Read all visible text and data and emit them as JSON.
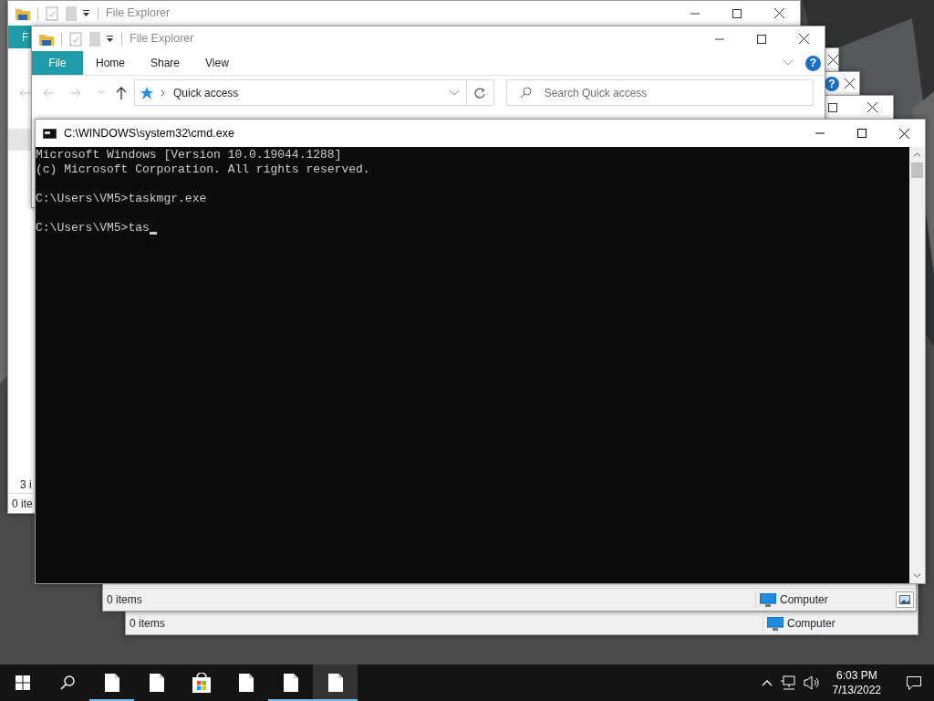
{
  "back_explorer": {
    "title": "File Explorer",
    "ribbon_tab": "F",
    "item_count": "3 i",
    "status": "0 ite"
  },
  "stacked_windows": [
    {
      "buttons": [
        {
          "kind": "close"
        }
      ]
    },
    {
      "buttons": [
        {
          "kind": "help",
          "label": "?"
        },
        {
          "kind": "close"
        }
      ]
    },
    {
      "buttons": [
        {
          "kind": "maximize"
        },
        {
          "kind": "close"
        }
      ]
    }
  ],
  "status_windows": [
    {
      "items": "0 items",
      "zone": "Computer",
      "view_button": true
    },
    {
      "items": "0 items",
      "zone": "Computer",
      "view_button": false
    }
  ],
  "front_explorer": {
    "title": "File Explorer",
    "tabs": [
      {
        "label": "File",
        "selected": true
      },
      {
        "label": "Home",
        "selected": false
      },
      {
        "label": "Share",
        "selected": false
      },
      {
        "label": "View",
        "selected": false
      }
    ],
    "help": "?",
    "address": "Quick access",
    "search": {
      "placeholder": "Search Quick access"
    }
  },
  "console": {
    "title": "C:\\WINDOWS\\system32\\cmd.exe",
    "blocks": [
      [
        "Microsoft Windows [Version 10.0.19044.1288]",
        "(c) Microsoft Corporation. All rights reserved."
      ],
      [
        "C:\\Users\\VM5>taskmgr.exe"
      ],
      [
        "C:\\Users\\VM5>tas"
      ]
    ],
    "cursor": true
  },
  "taskbar": {
    "apps": [
      {
        "kind": "file",
        "running": true,
        "selected": false
      },
      {
        "kind": "file",
        "running": false,
        "selected": false
      },
      {
        "kind": "store",
        "running": false,
        "selected": false
      },
      {
        "kind": "file",
        "running": false,
        "selected": false
      },
      {
        "kind": "file",
        "running": true,
        "selected": false
      },
      {
        "kind": "file",
        "running": true,
        "selected": true
      }
    ],
    "time": "6:03 PM",
    "date": "7/13/2022"
  }
}
